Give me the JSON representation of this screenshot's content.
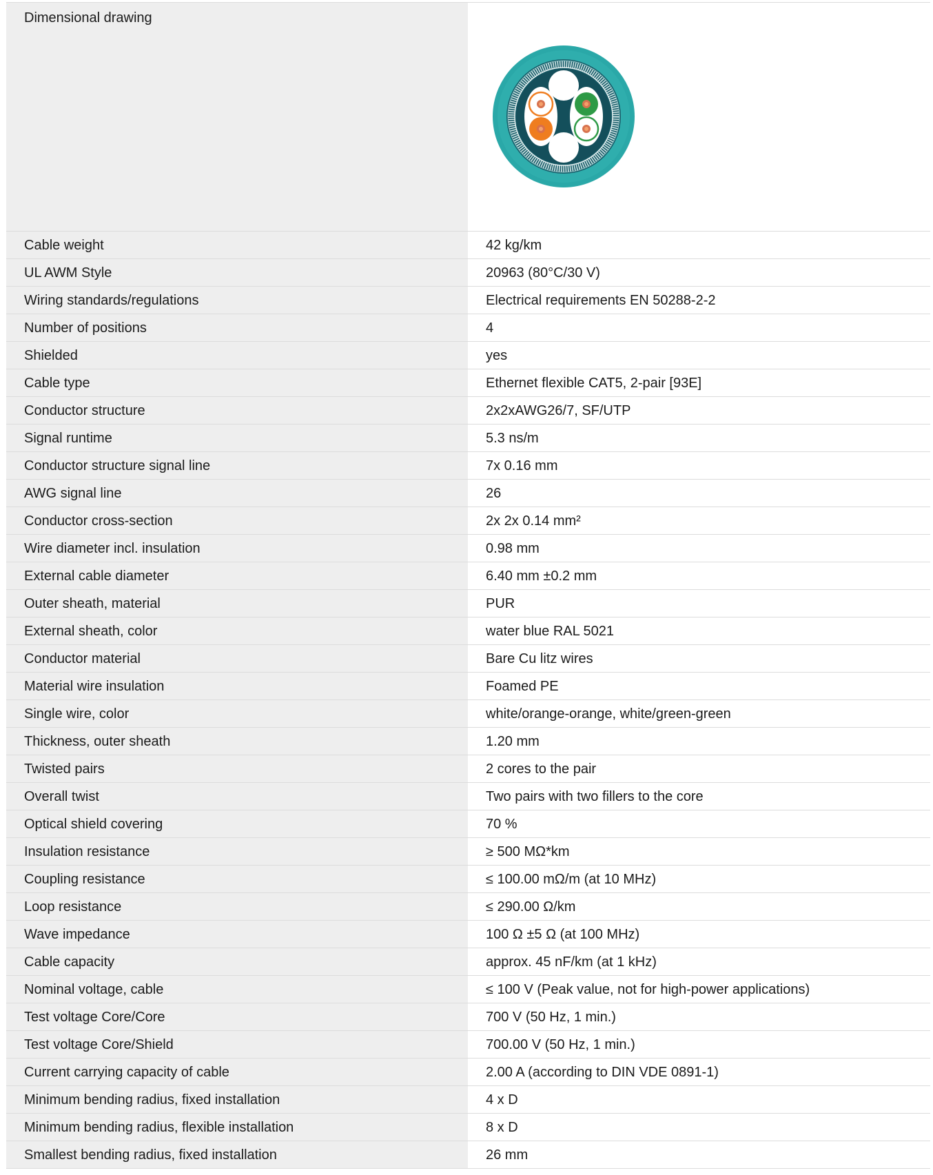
{
  "drawing": {
    "label": "Dimensional drawing",
    "image_name": "cable-cross-section"
  },
  "rows": [
    {
      "label": "Cable weight",
      "value": "42 kg/km"
    },
    {
      "label": "UL AWM Style",
      "value": "20963 (80°C/30 V)"
    },
    {
      "label": "Wiring standards/regulations",
      "value": "Electrical requirements EN 50288-2-2"
    },
    {
      "label": "Number of positions",
      "value": "4"
    },
    {
      "label": "Shielded",
      "value": "yes"
    },
    {
      "label": "Cable type",
      "value": "Ethernet flexible CAT5, 2-pair [93E]"
    },
    {
      "label": "Conductor structure",
      "value": "2x2xAWG26/7, SF/UTP"
    },
    {
      "label": "Signal runtime",
      "value": "5.3 ns/m"
    },
    {
      "label": "Conductor structure signal line",
      "value": "7x 0.16 mm"
    },
    {
      "label": "AWG signal line",
      "value": "26"
    },
    {
      "label": "Conductor cross-section",
      "value": "2x 2x 0.14 mm²"
    },
    {
      "label": "Wire diameter incl. insulation",
      "value": "0.98 mm"
    },
    {
      "label": "External cable diameter",
      "value": "6.40 mm ±0.2 mm"
    },
    {
      "label": "Outer sheath, material",
      "value": "PUR"
    },
    {
      "label": "External sheath, color",
      "value": "water blue RAL 5021"
    },
    {
      "label": "Conductor material",
      "value": "Bare Cu litz wires"
    },
    {
      "label": "Material wire insulation",
      "value": "Foamed PE"
    },
    {
      "label": "Single wire, color",
      "value": "white/orange-orange, white/green-green"
    },
    {
      "label": "Thickness, outer sheath",
      "value": "1.20 mm"
    },
    {
      "label": "Twisted pairs",
      "value": "2 cores to the pair"
    },
    {
      "label": "Overall twist",
      "value": "Two pairs with two fillers to the core"
    },
    {
      "label": "Optical shield covering",
      "value": "70 %"
    },
    {
      "label": "Insulation resistance",
      "value": "≥ 500 MΩ*km"
    },
    {
      "label": "Coupling resistance",
      "value": "≤ 100.00 mΩ/m (at 10 MHz)"
    },
    {
      "label": "Loop resistance",
      "value": "≤ 290.00 Ω/km"
    },
    {
      "label": "Wave impedance",
      "value": "100 Ω ±5 Ω (at 100 MHz)"
    },
    {
      "label": "Cable capacity",
      "value": "approx. 45 nF/km (at 1 kHz)"
    },
    {
      "label": "Nominal voltage, cable",
      "value": "≤ 100 V (Peak value, not for high-power applications)"
    },
    {
      "label": "Test voltage Core/Core",
      "value": "700 V (50 Hz, 1 min.)"
    },
    {
      "label": "Test voltage Core/Shield",
      "value": "700.00 V (50 Hz, 1 min.)"
    },
    {
      "label": "Current carrying capacity of cable",
      "value": "2.00 A (according to DIN VDE 0891-1)"
    },
    {
      "label": "Minimum bending radius, fixed installation",
      "value": "4 x D"
    },
    {
      "label": "Minimum bending radius, flexible installation",
      "value": "8 x D"
    },
    {
      "label": "Smallest bending radius, fixed installation",
      "value": "26 mm"
    }
  ],
  "colors": {
    "label_bg": "#eeeeee",
    "divider": "#dcdcdc",
    "sheath": "#2aa8a8",
    "core_bg": "#155a66",
    "orange": "#ef7d1f",
    "green": "#2e9a46"
  }
}
